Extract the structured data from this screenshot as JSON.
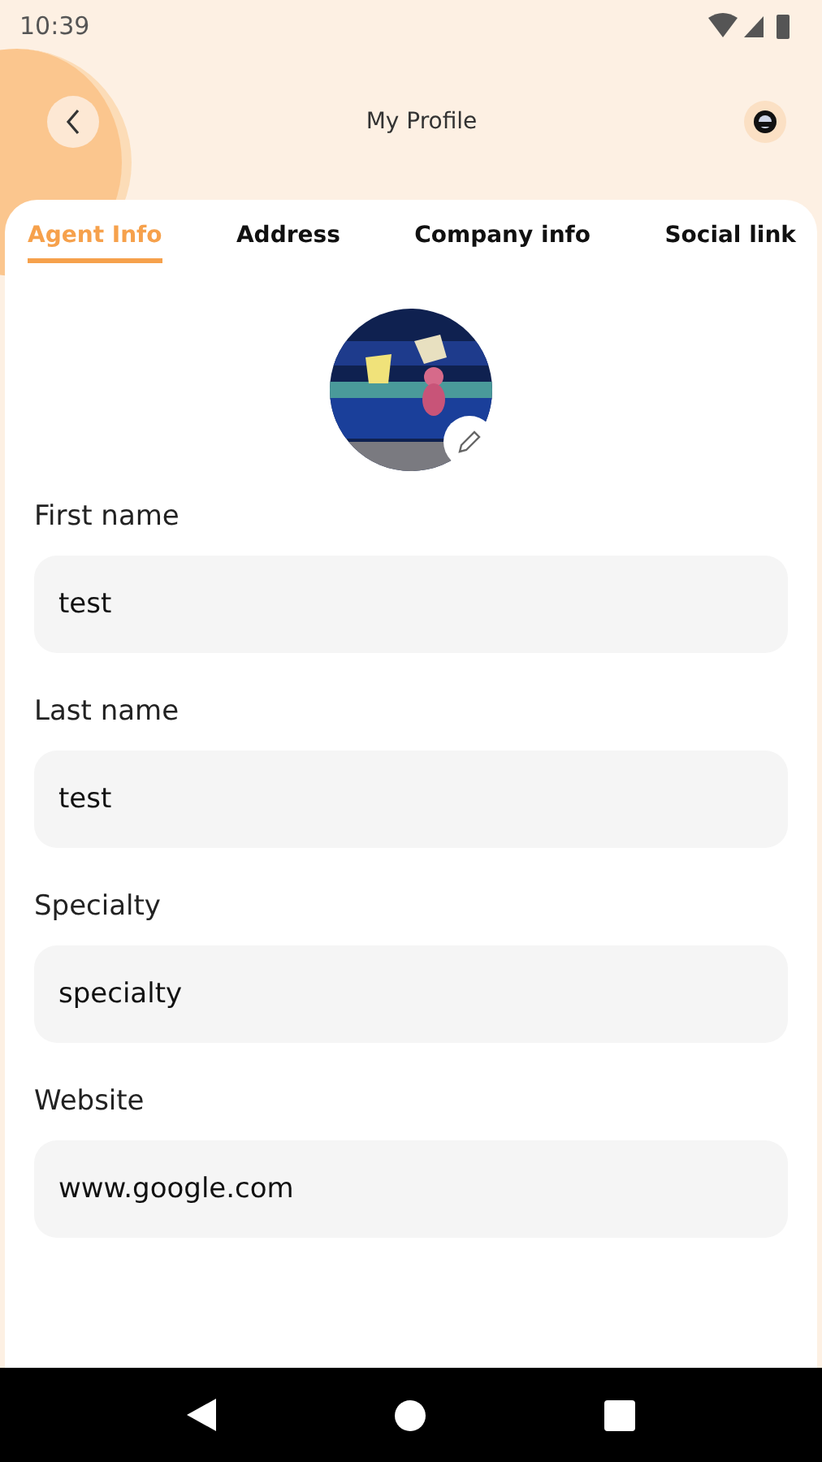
{
  "status_bar": {
    "time": "10:39"
  },
  "header": {
    "title": "My Profile"
  },
  "tabs": [
    {
      "label": "Agent Info",
      "selected": true
    },
    {
      "label": "Address",
      "selected": false
    },
    {
      "label": "Company info",
      "selected": false
    },
    {
      "label": "Social link",
      "selected": false
    }
  ],
  "fields": [
    {
      "label": "First name",
      "value": "test"
    },
    {
      "label": "Last name",
      "value": "test"
    },
    {
      "label": "Specialty",
      "value": "specialty"
    },
    {
      "label": "Website",
      "value": "www.google.com"
    }
  ]
}
